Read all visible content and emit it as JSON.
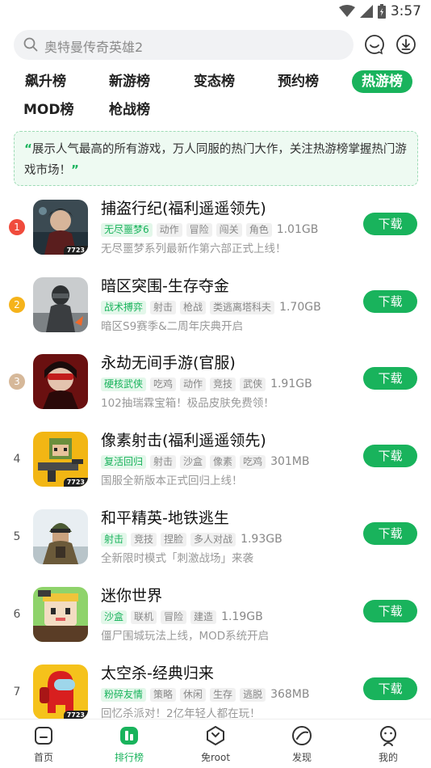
{
  "status_bar": {
    "time": "3:57"
  },
  "search": {
    "placeholder": "奥特曼传奇英雄2"
  },
  "tabs": [
    {
      "label": "飙升榜",
      "active": false
    },
    {
      "label": "新游榜",
      "active": false
    },
    {
      "label": "变态榜",
      "active": false
    },
    {
      "label": "预约榜",
      "active": false
    },
    {
      "label": "热游榜",
      "active": true
    },
    {
      "label": "MOD榜",
      "active": false
    },
    {
      "label": "枪战榜",
      "active": false
    }
  ],
  "banner": {
    "text": "展示人气最高的所有游戏，万人同服的热门大作，关注热游榜掌握热门游戏市场！"
  },
  "download_label": "下载",
  "icon_badge": "7723",
  "games": [
    {
      "rank": "1",
      "title": "捕盗行纪(福利遥遥领先)",
      "highlight_tag": "无尽噩梦6",
      "tags": [
        "动作",
        "冒险",
        "闯关",
        "角色"
      ],
      "size": "1.01GB",
      "desc": "无尽噩梦系列最新作第六部正式上线！"
    },
    {
      "rank": "2",
      "title": "暗区突围-生存夺金",
      "highlight_tag": "战术搏弈",
      "tags": [
        "射击",
        "枪战",
        "类逃离塔科夫"
      ],
      "size": "1.70GB",
      "desc": "暗区S9赛季&二周年庆典开启"
    },
    {
      "rank": "3",
      "title": "永劫无间手游(官服)",
      "highlight_tag": "硬核武侠",
      "tags": [
        "吃鸡",
        "动作",
        "竞技",
        "武侠"
      ],
      "size": "1.91GB",
      "desc": "102抽瑞霖宝箱！极品皮肤免费领！"
    },
    {
      "rank": "4",
      "title": "像素射击(福利遥遥领先)",
      "highlight_tag": "复活回归",
      "tags": [
        "射击",
        "沙盒",
        "像素",
        "吃鸡"
      ],
      "size": "301MB",
      "desc": "国服全新版本正式回归上线！"
    },
    {
      "rank": "5",
      "title": "和平精英-地铁逃生",
      "highlight_tag": "射击",
      "tags": [
        "竞技",
        "捏脸",
        "多人对战"
      ],
      "size": "1.93GB",
      "desc": "全新限时模式「刺激战场」来袭"
    },
    {
      "rank": "6",
      "title": "迷你世界",
      "highlight_tag": "沙盒",
      "tags": [
        "联机",
        "冒险",
        "建造"
      ],
      "size": "1.19GB",
      "desc": "僵尸围城玩法上线，MOD系统开启"
    },
    {
      "rank": "7",
      "title": "太空杀-经典归来",
      "highlight_tag": "粉碎友情",
      "tags": [
        "策略",
        "休闲",
        "生存",
        "逃脱"
      ],
      "size": "368MB",
      "desc": "回忆杀派对！2亿年轻人都在玩！"
    }
  ],
  "bottom_nav": [
    {
      "label": "首页",
      "icon": "home-icon",
      "active": false
    },
    {
      "label": "排行榜",
      "icon": "ranking-icon",
      "active": true
    },
    {
      "label": "免root",
      "icon": "no-root-icon",
      "active": false
    },
    {
      "label": "发现",
      "icon": "discover-icon",
      "active": false
    },
    {
      "label": "我的",
      "icon": "profile-icon",
      "active": false
    }
  ],
  "colors": {
    "accent": "#19b35c",
    "rank1": "#f04b3c",
    "rank2": "#f5b31b",
    "rank3": "#d6b899"
  }
}
